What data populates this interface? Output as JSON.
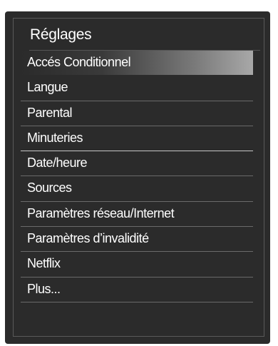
{
  "menu": {
    "title": "Réglages",
    "selected_index": 0,
    "items": [
      {
        "label": "Accés Conditionnel"
      },
      {
        "label": "Langue"
      },
      {
        "label": "Parental"
      },
      {
        "label": "Minuteries"
      },
      {
        "label": "Date/heure"
      },
      {
        "label": "Sources"
      },
      {
        "label": "Paramètres réseau/Internet"
      },
      {
        "label": "Paramètres d’invalidité"
      },
      {
        "label": "Netflix"
      },
      {
        "label": "Plus..."
      }
    ]
  },
  "colors": {
    "panel_background": "#2b2b2b",
    "text": "#ffffff",
    "highlight_end": "#a8a8a8",
    "page_background": "#ffffff"
  }
}
